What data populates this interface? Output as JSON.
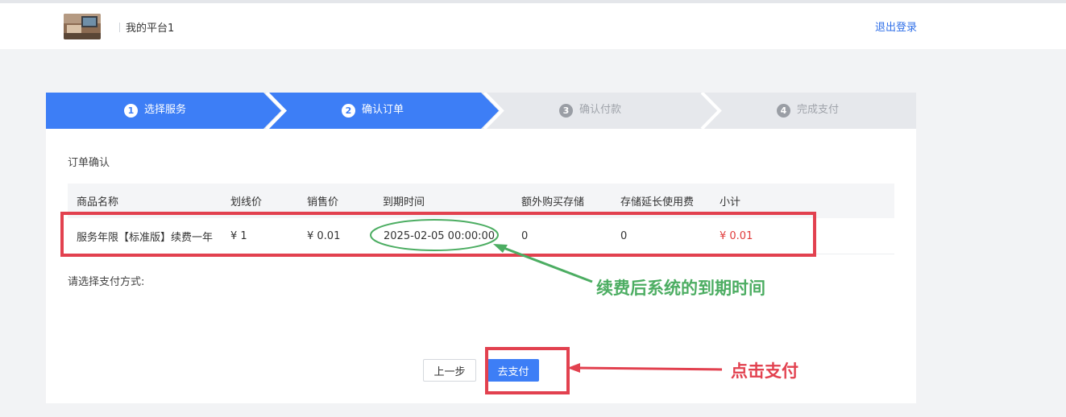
{
  "header": {
    "platform_name": "我的平台1",
    "logout_label": "退出登录"
  },
  "steps": [
    {
      "num": "1",
      "label": "选择服务",
      "state": "active"
    },
    {
      "num": "2",
      "label": "确认订单",
      "state": "active"
    },
    {
      "num": "3",
      "label": "确认付款",
      "state": "inactive"
    },
    {
      "num": "4",
      "label": "完成支付",
      "state": "inactive"
    }
  ],
  "order": {
    "section_title": "订单确认",
    "columns": [
      "商品名称",
      "划线价",
      "销售价",
      "到期时间",
      "额外购买存储",
      "存储延长使用费",
      "小计"
    ],
    "rows": [
      {
        "name": "服务年限【标准版】续费一年",
        "list_price": "¥ 1",
        "sale_price": "¥ 0.01",
        "expire_time": "2025-02-05 00:00:00",
        "extra_storage": "0",
        "storage_extension_fee": "0",
        "subtotal": "¥ 0.01"
      }
    ]
  },
  "payment": {
    "title": "请选择支付方式:",
    "prev_label": "上一步",
    "pay_label": "去支付"
  },
  "annotations": {
    "expire_note": "续费后系统的到期时间",
    "pay_note": "点击支付"
  },
  "colors": {
    "primary": "#3d7ef6",
    "step_inactive": "#e6e8ec",
    "price_red": "#e03b3b",
    "annotation_red": "#e2414f",
    "annotation_green": "#4cad62"
  }
}
